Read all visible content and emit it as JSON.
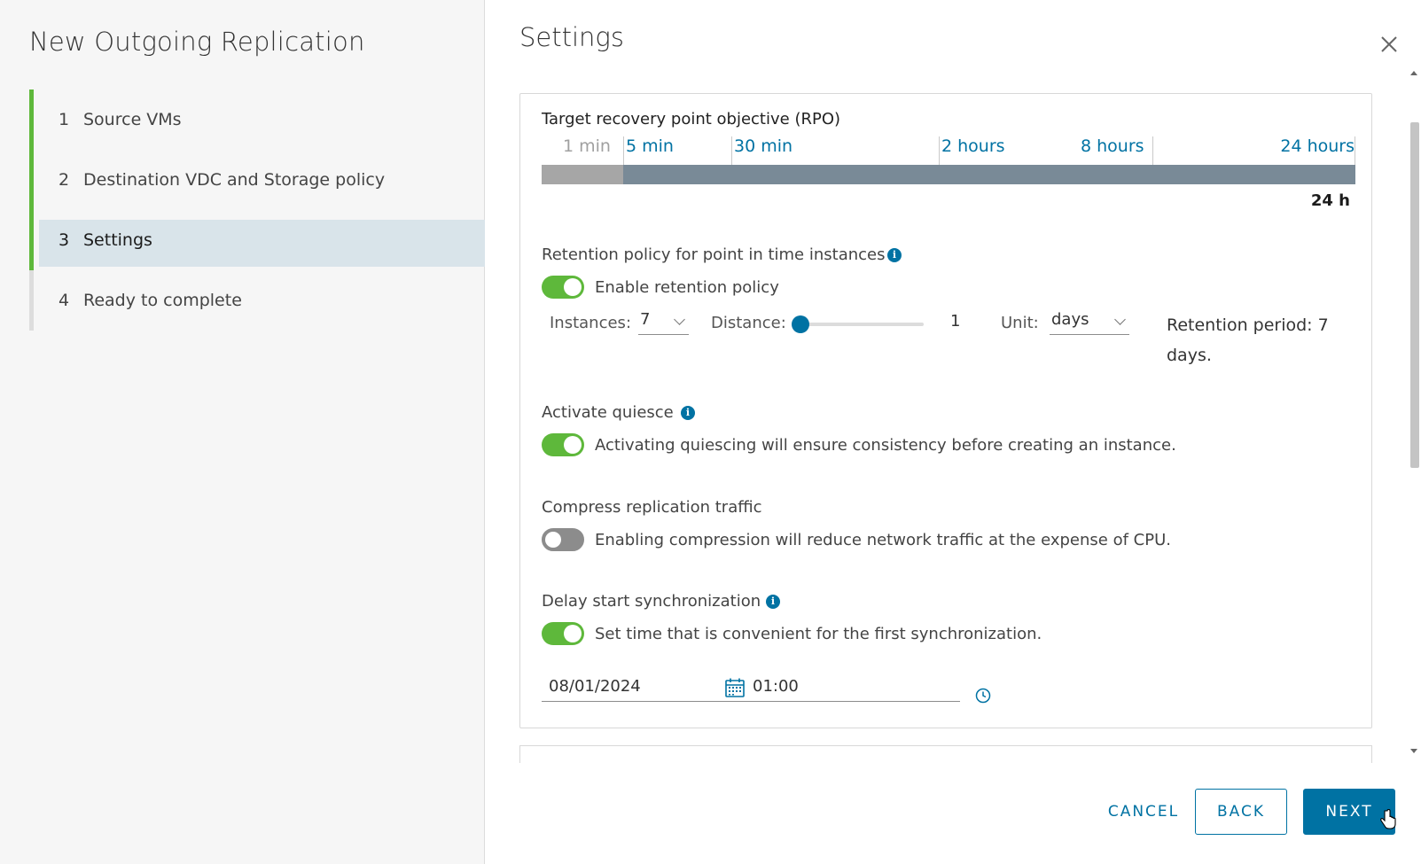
{
  "wizard": {
    "title": "New Outgoing Replication",
    "steps": [
      {
        "num": "1",
        "label": "Source VMs",
        "state": "done"
      },
      {
        "num": "2",
        "label": "Destination VDC and Storage policy",
        "state": "done"
      },
      {
        "num": "3",
        "label": "Settings",
        "state": "active"
      },
      {
        "num": "4",
        "label": "Ready to complete",
        "state": "todo"
      }
    ]
  },
  "page": {
    "title": "Settings",
    "close_icon": "close-icon"
  },
  "rpo": {
    "label": "Target recovery point objective (RPO)",
    "ticks": [
      "1 min",
      "5 min",
      "30 min",
      "2 hours",
      "8 hours",
      "24 hours"
    ],
    "disabled_ticks": [
      "1 min"
    ],
    "value": "24 h"
  },
  "retention": {
    "label": "Retention policy for point in time instances",
    "toggle_label": "Enable retention policy",
    "enabled": true,
    "instances_label": "Instances:",
    "instances_value": "7",
    "distance_label": "Distance:",
    "distance_value": "1",
    "unit_label": "Unit:",
    "unit_value": "days",
    "period_text": "Retention period: 7 days."
  },
  "quiesce": {
    "label": "Activate quiesce",
    "toggle_label": "Activating quiescing will ensure consistency before creating an instance.",
    "enabled": true
  },
  "compress": {
    "label": "Compress replication traffic",
    "toggle_label": "Enabling compression will reduce network traffic at the expense of CPU.",
    "enabled": false
  },
  "delay": {
    "label": "Delay start synchronization",
    "toggle_label": "Set time that is convenient for the first synchronization.",
    "enabled": true,
    "date_value": "08/01/2024",
    "time_value": "01:00"
  },
  "footer": {
    "cancel_label": "CANCEL",
    "back_label": "BACK",
    "next_label": "NEXT"
  },
  "colors": {
    "accent": "#0072a3",
    "toggle_on": "#5eb83b",
    "progress_done": "#5eb83b",
    "active_step_bg": "#d9e4ea"
  }
}
